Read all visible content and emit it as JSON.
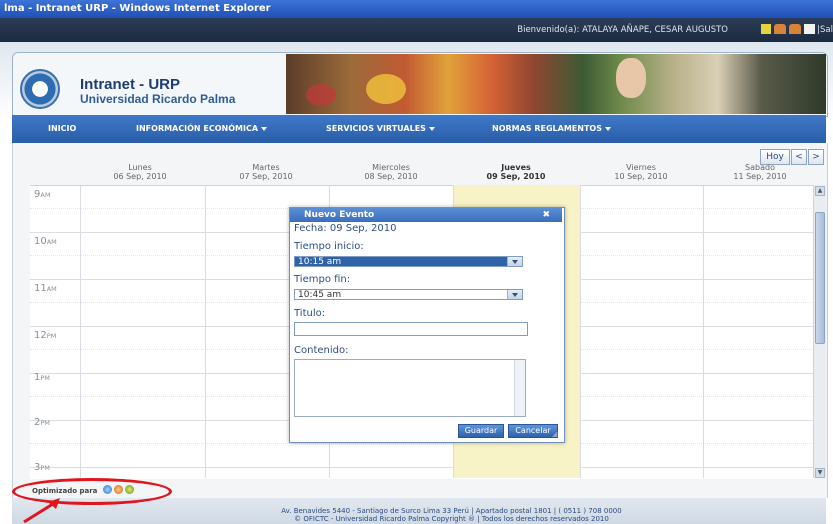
{
  "window": {
    "title": "lma - Intranet URP - Windows Internet Explorer"
  },
  "welcome": {
    "text": "Bienvenido(a): ATALAYA AÑAPE, CESAR AUGUSTO",
    "trailing": "|Sal"
  },
  "brand": {
    "line1": "Intranet - URP",
    "line2": "Universidad Ricardo Palma"
  },
  "nav": {
    "items": [
      {
        "label": "INICIO",
        "dropdown": false
      },
      {
        "label": "INFORMACIÓN ECONÓMICA",
        "dropdown": true
      },
      {
        "label": "SERVICIOS VIRTUALES",
        "dropdown": true
      },
      {
        "label": "NORMAS REGLAMENTOS",
        "dropdown": true
      }
    ]
  },
  "calendar": {
    "today_button": "Hoy",
    "prev": "<",
    "next": ">",
    "days": [
      {
        "name": "Lunes",
        "date": "06 Sep, 2010"
      },
      {
        "name": "Martes",
        "date": "07 Sep, 2010"
      },
      {
        "name": "Miercoles",
        "date": "08 Sep, 2010"
      },
      {
        "name": "Jueves",
        "date": "09 Sep, 2010"
      },
      {
        "name": "Viernes",
        "date": "10 Sep, 2010"
      },
      {
        "name": "Sabado",
        "date": "11 Sep, 2010"
      }
    ],
    "hours": [
      {
        "num": "9",
        "ampm": "AM"
      },
      {
        "num": "10",
        "ampm": "AM"
      },
      {
        "num": "11",
        "ampm": "AM"
      },
      {
        "num": "12",
        "ampm": "PM"
      },
      {
        "num": "1",
        "ampm": "PM"
      },
      {
        "num": "2",
        "ampm": "PM"
      },
      {
        "num": "3",
        "ampm": "PM"
      }
    ]
  },
  "dialog": {
    "title": "Nuevo Evento",
    "close": "✖",
    "fecha": "Fecha: 09 Sep, 2010",
    "inicio_label": "Tiempo inicio:",
    "inicio_value": "10:15 am",
    "fin_label": "Tiempo fin:",
    "fin_value": "10:45 am",
    "titulo_label": "Titulo:",
    "titulo_value": "",
    "contenido_label": "Contenido:",
    "guardar": "Guardar",
    "cancelar": "Cancelar"
  },
  "footer": {
    "optimized": "Optimizado para",
    "line1": "Av. Benavides 5440 - Santiago de Surco Lima 33 Perú | Apartado postal 1801 | ( 0511 ) 708 0000",
    "line2": "© OFICTC - Universidad Ricardo Palma Copyright ® | Todos los derechos reservados 2010"
  },
  "colors": {
    "accent": "#2f62a8",
    "today_column": "#f7f3c6",
    "annotation": "#e1151d"
  }
}
